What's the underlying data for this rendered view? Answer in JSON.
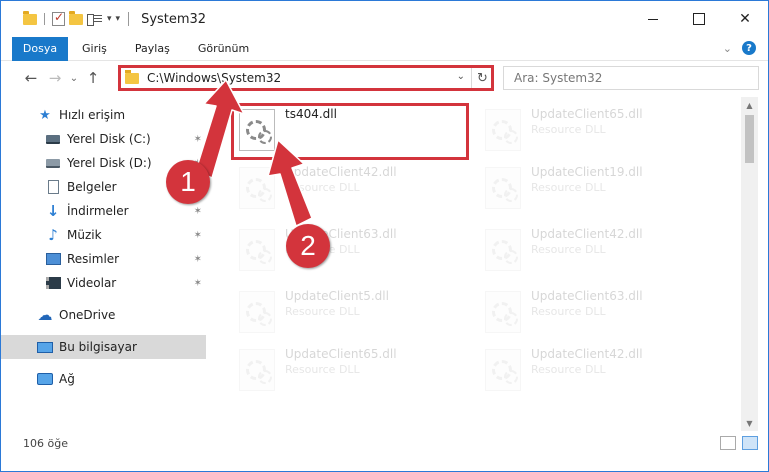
{
  "window": {
    "title": "System32",
    "controls": {
      "minimize": "",
      "maximize": "",
      "close": "✕"
    }
  },
  "ribbon": {
    "tabs": [
      "Dosya",
      "Giriş",
      "Paylaş",
      "Görünüm"
    ],
    "help": "?",
    "expand": "⌄"
  },
  "nav": {
    "back": "←",
    "forward": "→",
    "recent": "⌄",
    "up": "↑"
  },
  "address": {
    "path": "C:\\Windows\\System32",
    "dropdown": "⌄",
    "refresh": "↻"
  },
  "search": {
    "placeholder": "Ara: System32"
  },
  "sidebar": {
    "items": [
      {
        "label": "Hızlı erişim",
        "icon": "star-icon",
        "pinned": false
      },
      {
        "label": "Yerel Disk (C:)",
        "icon": "drive-icon",
        "pinned": true
      },
      {
        "label": "Yerel Disk (D:)",
        "icon": "drive-icon",
        "pinned": true
      },
      {
        "label": "Belgeler",
        "icon": "document-icon",
        "pinned": true
      },
      {
        "label": "İndirmeler",
        "icon": "download-icon",
        "pinned": true
      },
      {
        "label": "Müzik",
        "icon": "music-icon",
        "pinned": true
      },
      {
        "label": "Resimler",
        "icon": "pictures-icon",
        "pinned": true
      },
      {
        "label": "Videolar",
        "icon": "video-icon",
        "pinned": true
      },
      {
        "label": "OneDrive",
        "icon": "cloud-icon",
        "pinned": false
      },
      {
        "label": "Bu bilgisayar",
        "icon": "computer-icon",
        "pinned": false
      },
      {
        "label": "Ağ",
        "icon": "network-icon",
        "pinned": false
      }
    ],
    "pin_glyph": "📌"
  },
  "files": {
    "highlighted": {
      "name": "ts404.dll",
      "type": ""
    },
    "left_column": [
      {
        "name": "UpdateClient42.dll",
        "type": "Resource DLL"
      },
      {
        "name": "UpdateClient63.dll",
        "type": "Resource DLL"
      },
      {
        "name": "UpdateClient5.dll",
        "type": "Resource DLL"
      },
      {
        "name": "UpdateClient65.dll",
        "type": "Resource DLL"
      }
    ],
    "right_column": [
      {
        "name": "UpdateClient65.dll",
        "type": "Resource DLL"
      },
      {
        "name": "UpdateClient19.dll",
        "type": "Resource DLL"
      },
      {
        "name": "UpdateClient42.dll",
        "type": "Resource DLL"
      },
      {
        "name": "UpdateClient63.dll",
        "type": "Resource DLL"
      },
      {
        "name": "UpdateClient42.dll",
        "type": "Resource DLL"
      }
    ]
  },
  "status": {
    "count": "106 öğe"
  },
  "annotations": {
    "step1": "1",
    "step2": "2",
    "color": "#d3343c"
  },
  "colors": {
    "accent": "#1979ca",
    "highlight": "#d3343c"
  }
}
